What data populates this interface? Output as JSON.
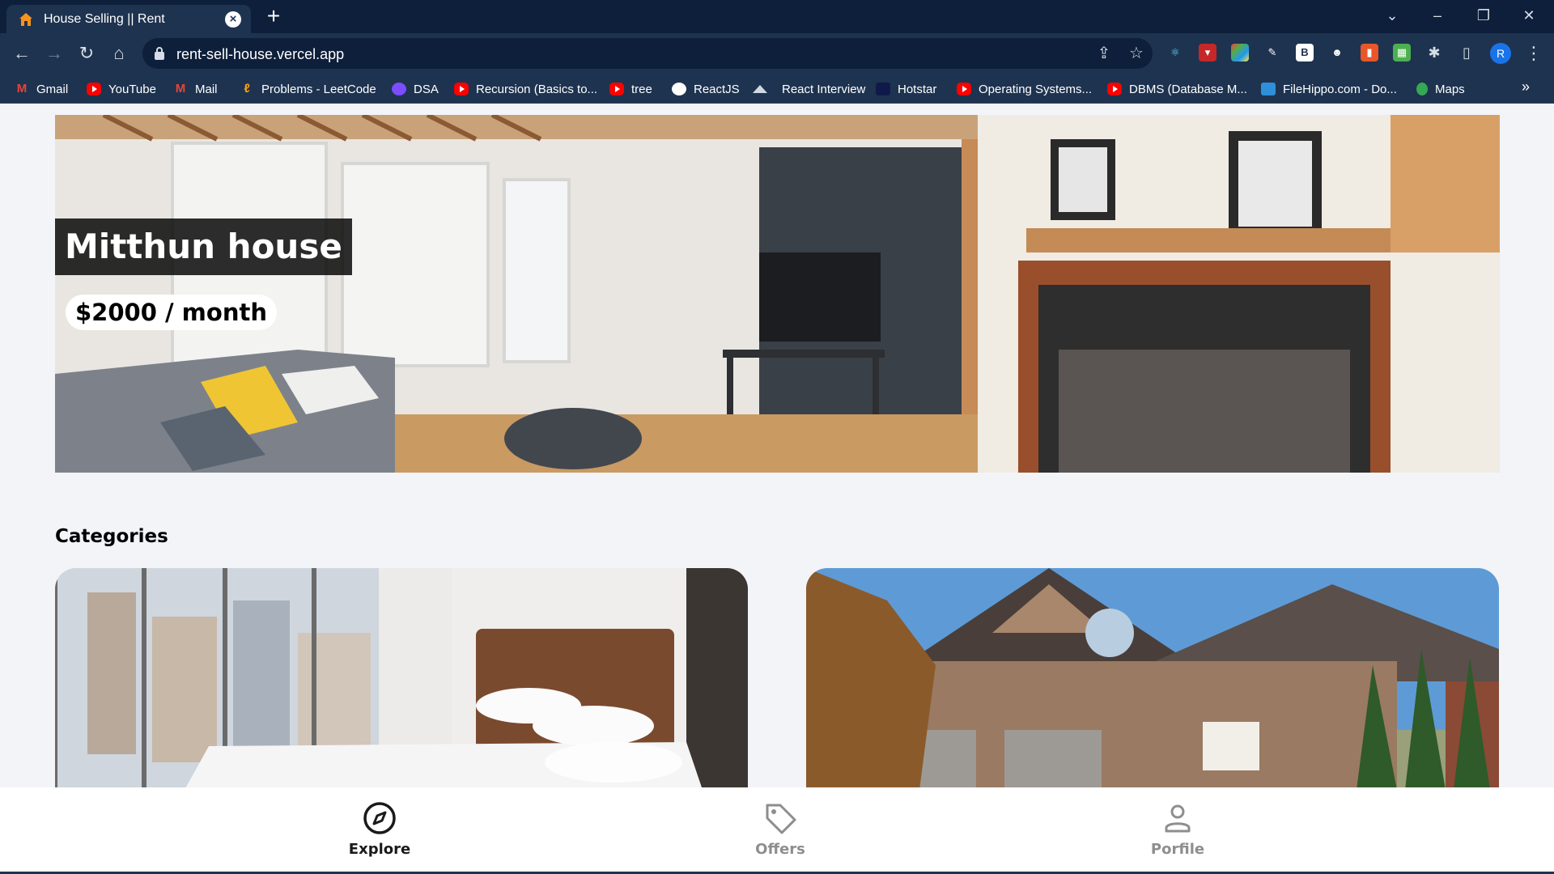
{
  "browser": {
    "tab_title": "House Selling || Rent",
    "url": "rent-sell-house.vercel.app",
    "profile_initial": "R",
    "bookmarks": [
      {
        "label": "Gmail",
        "icon": "gmail-icon"
      },
      {
        "label": "YouTube",
        "icon": "youtube-icon"
      },
      {
        "label": "Mail",
        "icon": "gmail-icon"
      },
      {
        "label": "Problems - LeetCode",
        "icon": "leetcode-icon"
      },
      {
        "label": "DSA",
        "icon": "shield-icon"
      },
      {
        "label": "Recursion (Basics to...",
        "icon": "youtube-icon"
      },
      {
        "label": "tree",
        "icon": "youtube-icon"
      },
      {
        "label": "ReactJS",
        "icon": "github-icon"
      },
      {
        "label": "React Interview",
        "icon": "mountain-icon"
      },
      {
        "label": "Hotstar",
        "icon": "hotstar-icon"
      },
      {
        "label": "Operating Systems...",
        "icon": "youtube-icon"
      },
      {
        "label": "DBMS (Database M...",
        "icon": "youtube-icon"
      },
      {
        "label": "FileHippo.com - Do...",
        "icon": "filehippo-icon"
      },
      {
        "label": "Maps",
        "icon": "maps-pin-icon"
      }
    ]
  },
  "hero": {
    "title": "Mitthun house",
    "price": "$2000 / month"
  },
  "categories": {
    "heading": "Categories",
    "items": [
      {
        "image": "bedroom-photo"
      },
      {
        "image": "house-exterior-photo"
      }
    ]
  },
  "bottom_nav": {
    "items": [
      {
        "label": "Explore",
        "icon": "compass-icon",
        "active": true
      },
      {
        "label": "Offers",
        "icon": "tag-icon",
        "active": false
      },
      {
        "label": "Porfile",
        "icon": "person-icon",
        "active": false
      }
    ]
  },
  "colors": {
    "chrome_dark": "#0d1f3a",
    "chrome": "#1e3350",
    "page_bg": "#f2f4f8",
    "active_nav": "#1a1a1a",
    "inactive_nav": "#8e8e8e"
  }
}
